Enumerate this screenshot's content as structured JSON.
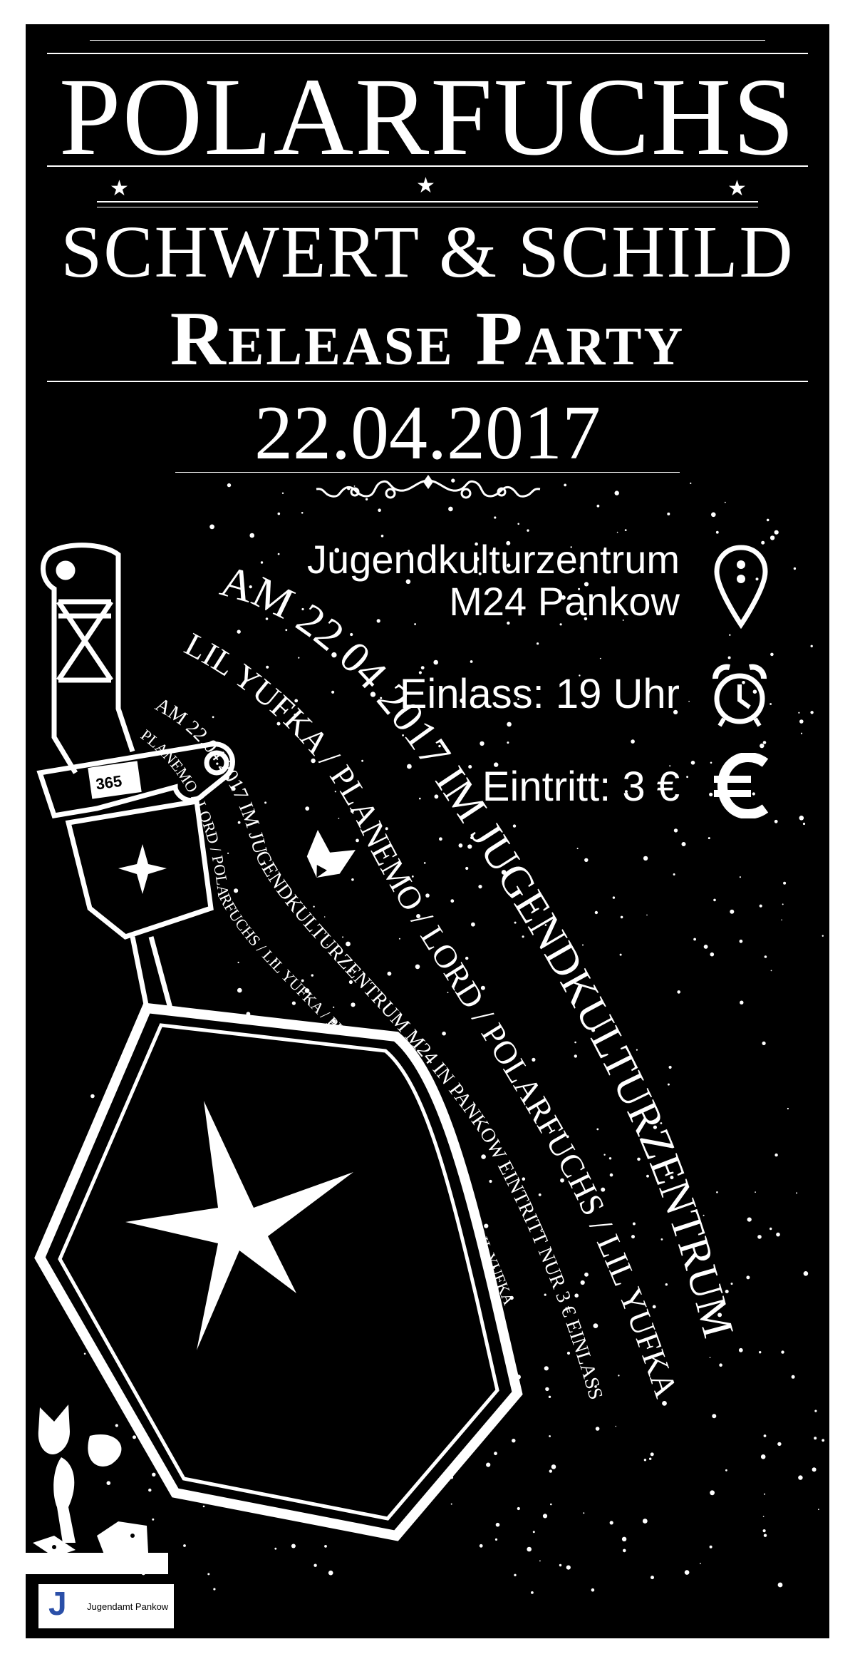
{
  "title": "POLARFUCHS",
  "subtitle": "SCHWERT & SCHILD",
  "event": "Release Party",
  "date": "22.04.2017",
  "venue": {
    "line1": "Jugendkulturzentrum",
    "line2": "M24 Pankow"
  },
  "entry": "Einlass: 19 Uhr",
  "price": "Eintritt: 3 €",
  "curved_text": {
    "line1": "AM 22.04.2017 IM JUGENDKULTURZENTRUM",
    "line2": "LIL YUFKA / PLANEMO / LORD / POLARFUCHS / LIL YUFKA",
    "line3": "AM 22.04.2017 IM JUGENDKULTURZENTRUM M24 IN PANKOW EINTRITT NUR 3 € EINLASS",
    "line4": "PLANEMO / LORD / POLARFUCHS / LIL YUFKA / PLANEMO / LORD / POLARFUCHS / LIL YUFKA"
  },
  "sword_badge": "365",
  "sponsor": {
    "logo_letter": "J",
    "name": "Jugendamt Pankow"
  },
  "colors": {
    "background": "#000000",
    "foreground": "#ffffff",
    "logo_accent": "#2a4fa8"
  },
  "icons": [
    "map-pin-icon",
    "alarm-clock-icon",
    "euro-icon",
    "compass-star-icon",
    "sword-icon",
    "shield-icon",
    "fox-icon",
    "flourish-ornament"
  ]
}
